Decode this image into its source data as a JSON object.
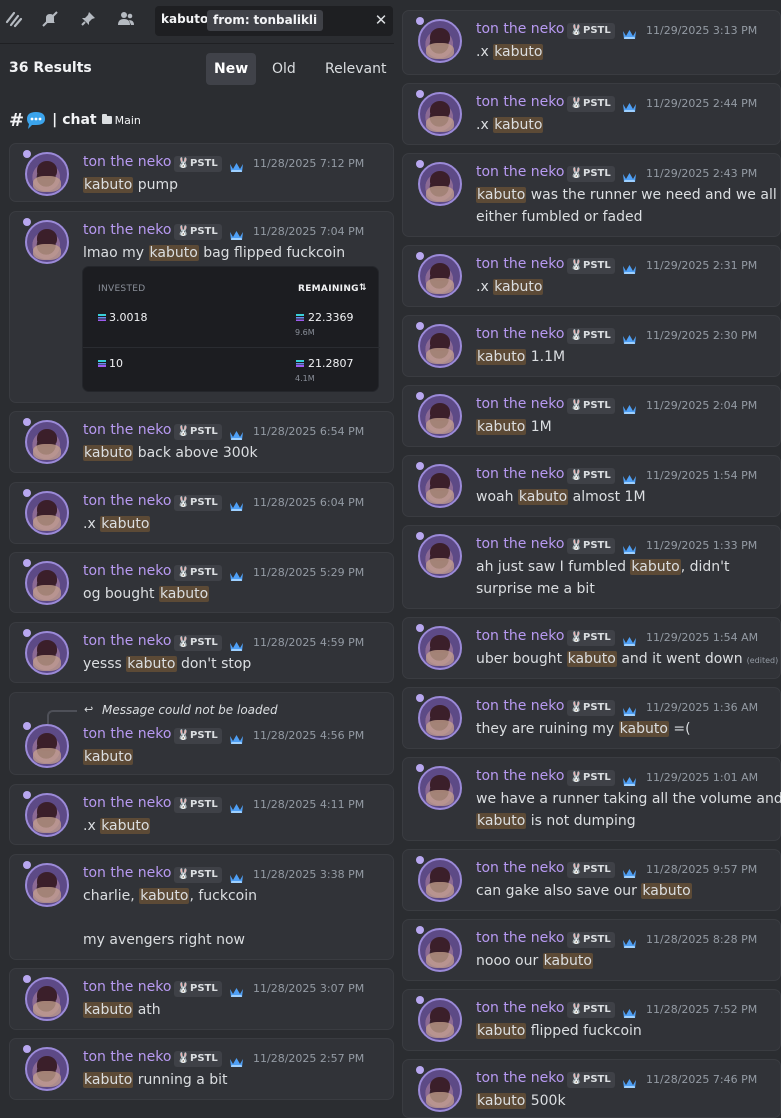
{
  "search": {
    "query_text": "kabuto",
    "filter_key": "from:",
    "filter_value": "tonbalikli",
    "clear_label": "✕"
  },
  "toolbar_icons": [
    "threads-icon",
    "mute-bell-icon",
    "pin-icon",
    "members-icon"
  ],
  "results": {
    "count_label": "36 Results",
    "sort_tabs": [
      "New",
      "Old",
      "Relevant"
    ],
    "active_sort": "New"
  },
  "channel": {
    "hash": "#",
    "separator": "|",
    "name": "chat",
    "category": "Main"
  },
  "user": {
    "name": "ton the neko",
    "tag": "PSTL"
  },
  "embed": {
    "col_invested": "INVESTED",
    "col_remaining": "REMAINING",
    "remaining_arrows": "⇅",
    "rows": [
      {
        "invested": "3.0018",
        "remaining": "22.3369",
        "remaining_sub": "9.6M"
      },
      {
        "invested": "10",
        "remaining": "21.2807",
        "remaining_sub": "4.1M"
      }
    ]
  },
  "reply_notice": "Message could not be loaded",
  "left_messages": [
    {
      "time": "11/28/2025 7:12 PM",
      "lines": [
        [
          {
            "t": "kabuto",
            "h": true
          },
          {
            "t": " pump"
          }
        ]
      ]
    },
    {
      "time": "11/28/2025 7:04 PM",
      "lines": [
        [
          {
            "t": "lmao my "
          },
          {
            "t": "kabuto",
            "h": true
          },
          {
            "t": " bag flipped fuckcoin"
          }
        ]
      ],
      "has_embed": true
    },
    {
      "time": "11/28/2025 6:54 PM",
      "lines": [
        [
          {
            "t": "kabuto",
            "h": true
          },
          {
            "t": " back above 300k"
          }
        ]
      ]
    },
    {
      "time": "11/28/2025 6:04 PM",
      "lines": [
        [
          {
            "t": ".x "
          },
          {
            "t": "kabuto",
            "h": true
          }
        ]
      ]
    },
    {
      "time": "11/28/2025 5:29 PM",
      "lines": [
        [
          {
            "t": "og bought "
          },
          {
            "t": "kabuto",
            "h": true
          }
        ]
      ]
    },
    {
      "time": "11/28/2025 4:59 PM",
      "lines": [
        [
          {
            "t": "yesss "
          },
          {
            "t": "kabuto",
            "h": true
          },
          {
            "t": " don't stop"
          }
        ]
      ]
    },
    {
      "time": "11/28/2025 4:56 PM",
      "lines": [
        [
          {
            "t": "kabuto",
            "h": true
          }
        ]
      ],
      "reply": true
    },
    {
      "time": "11/28/2025 4:11 PM",
      "lines": [
        [
          {
            "t": ".x "
          },
          {
            "t": "kabuto",
            "h": true
          }
        ]
      ]
    },
    {
      "time": "11/28/2025 3:38 PM",
      "lines": [
        [
          {
            "t": "charlie, "
          },
          {
            "t": "kabuto",
            "h": true
          },
          {
            "t": ", fuckcoin"
          }
        ],
        [],
        [
          {
            "t": "my avengers right now"
          }
        ]
      ]
    },
    {
      "time": "11/28/2025 3:07 PM",
      "lines": [
        [
          {
            "t": "kabuto",
            "h": true
          },
          {
            "t": " ath"
          }
        ]
      ]
    },
    {
      "time": "11/28/2025 2:57 PM",
      "lines": [
        [
          {
            "t": "kabuto",
            "h": true
          },
          {
            "t": " running a bit"
          }
        ]
      ]
    }
  ],
  "right_messages": [
    {
      "time": "11/29/2025 3:13 PM",
      "lines": [
        [
          {
            "t": ".x "
          },
          {
            "t": "kabuto",
            "h": true
          }
        ]
      ]
    },
    {
      "time": "11/29/2025 2:44 PM",
      "lines": [
        [
          {
            "t": ".x "
          },
          {
            "t": "kabuto",
            "h": true
          }
        ]
      ]
    },
    {
      "time": "11/29/2025 2:43 PM",
      "lines": [
        [
          {
            "t": "kabuto",
            "h": true
          },
          {
            "t": " was the runner we need and we all"
          }
        ],
        [
          {
            "t": "either fumbled or faded"
          }
        ]
      ]
    },
    {
      "time": "11/29/2025 2:31 PM",
      "lines": [
        [
          {
            "t": ".x "
          },
          {
            "t": "kabuto",
            "h": true
          }
        ]
      ]
    },
    {
      "time": "11/29/2025 2:30 PM",
      "lines": [
        [
          {
            "t": "kabuto",
            "h": true
          },
          {
            "t": " 1.1M"
          }
        ]
      ]
    },
    {
      "time": "11/29/2025 2:04 PM",
      "lines": [
        [
          {
            "t": "kabuto",
            "h": true
          },
          {
            "t": " 1M"
          }
        ]
      ]
    },
    {
      "time": "11/29/2025 1:54 PM",
      "lines": [
        [
          {
            "t": "woah "
          },
          {
            "t": "kabuto",
            "h": true
          },
          {
            "t": " almost 1M"
          }
        ]
      ]
    },
    {
      "time": "11/29/2025 1:33 PM",
      "lines": [
        [
          {
            "t": "ah just saw I fumbled "
          },
          {
            "t": "kabuto",
            "h": true
          },
          {
            "t": ", didn't"
          }
        ],
        [
          {
            "t": "surprise me a bit"
          }
        ]
      ]
    },
    {
      "time": "11/29/2025 1:54 AM",
      "lines": [
        [
          {
            "t": "uber bought "
          },
          {
            "t": "kabuto",
            "h": true
          },
          {
            "t": " and it went down"
          },
          {
            "t": "(edited)",
            "e": true
          }
        ]
      ]
    },
    {
      "time": "11/29/2025 1:36 AM",
      "lines": [
        [
          {
            "t": "they are ruining my "
          },
          {
            "t": "kabuto",
            "h": true
          },
          {
            "t": " =("
          }
        ]
      ]
    },
    {
      "time": "11/29/2025 1:01 AM",
      "lines": [
        [
          {
            "t": "we have a runner taking all the volume and"
          }
        ],
        [
          {
            "t": "kabuto",
            "h": true
          },
          {
            "t": " is not dumping"
          }
        ]
      ]
    },
    {
      "time": "11/28/2025 9:57 PM",
      "lines": [
        [
          {
            "t": "can gake also save our "
          },
          {
            "t": "kabuto",
            "h": true
          }
        ]
      ]
    },
    {
      "time": "11/28/2025 8:28 PM",
      "lines": [
        [
          {
            "t": "nooo our "
          },
          {
            "t": "kabuto",
            "h": true
          }
        ]
      ]
    },
    {
      "time": "11/28/2025 7:52 PM",
      "lines": [
        [
          {
            "t": "kabuto",
            "h": true
          },
          {
            "t": " flipped fuckcoin"
          }
        ]
      ]
    },
    {
      "time": "11/28/2025 7:46 PM",
      "lines": [
        [
          {
            "t": "kabuto",
            "h": true
          },
          {
            "t": " 500k"
          }
        ]
      ]
    }
  ]
}
